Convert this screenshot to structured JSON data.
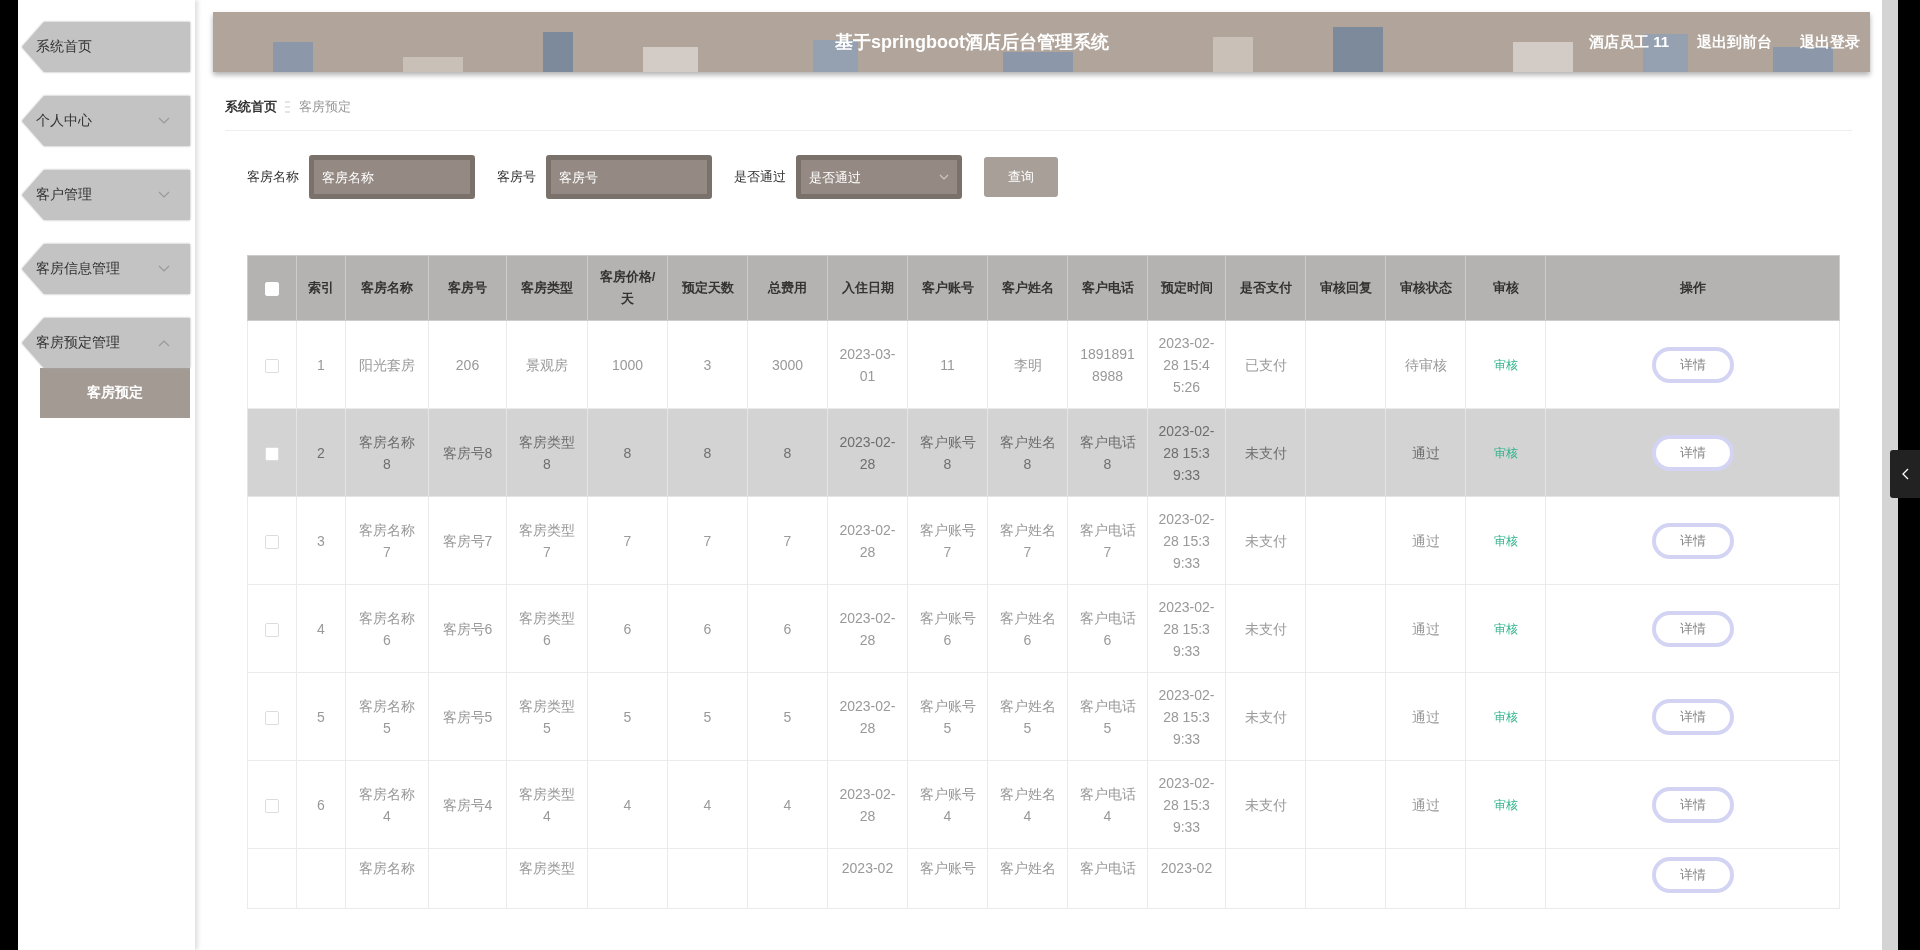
{
  "sidebar": {
    "items": [
      {
        "label": "系统首页",
        "kind": "link"
      },
      {
        "label": "个人中心",
        "kind": "menu",
        "expanded": false
      },
      {
        "label": "客户管理",
        "kind": "menu",
        "expanded": false
      },
      {
        "label": "客房信息管理",
        "kind": "menu",
        "expanded": false
      },
      {
        "label": "客房预定管理",
        "kind": "menu",
        "expanded": true,
        "children": [
          {
            "label": "客房预定",
            "selected": true
          }
        ]
      }
    ]
  },
  "header": {
    "title": "基于springboot酒店后台管理系统",
    "links": [
      "酒店员工 11",
      "退出到前台",
      "退出登录"
    ]
  },
  "breadcrumb": [
    "系统首页",
    "客房预定"
  ],
  "search": {
    "fields": [
      {
        "label": "客房名称",
        "placeholder": "客房名称",
        "kind": "text"
      },
      {
        "label": "客房号",
        "placeholder": "客房号",
        "kind": "text"
      },
      {
        "label": "是否通过",
        "placeholder": "是否通过",
        "kind": "select"
      }
    ],
    "button": "查询"
  },
  "table": {
    "select_all": {
      "checked": false
    },
    "columns": [
      "索引",
      "客房名称",
      "客房号",
      "客房类型",
      "客房价格/天",
      "预定天数",
      "总费用",
      "入住日期",
      "客户账号",
      "客户姓名",
      "客户电话",
      "预定时间",
      "是否支付",
      "审核回复",
      "审核状态",
      "审核",
      "操作"
    ],
    "rows": [
      {
        "kind": "full",
        "selected": false,
        "checked": false,
        "cells": [
          "1",
          "阳光套房",
          "206",
          "景观房",
          "1000",
          "3",
          "3000",
          "2023-03-01",
          "11",
          "李明",
          "18918918988",
          "2023-02-28 15:45:26",
          "已支付",
          null,
          "待审核"
        ],
        "review": "审核",
        "action": "详情"
      },
      {
        "kind": "full",
        "selected": true,
        "checked": false,
        "cells": [
          "2",
          "客房名称8",
          "客房号8",
          "客房类型8",
          "8",
          "8",
          "8",
          "2023-02-28",
          "客户账号8",
          "客户姓名8",
          "客户电话8",
          "2023-02-28 15:39:33",
          "未支付",
          null,
          "通过"
        ],
        "review": "审核",
        "action": "详情"
      },
      {
        "kind": "full",
        "selected": false,
        "checked": false,
        "cells": [
          "3",
          "客房名称7",
          "客房号7",
          "客房类型7",
          "7",
          "7",
          "7",
          "2023-02-28",
          "客户账号7",
          "客户姓名7",
          "客户电话7",
          "2023-02-28 15:39:33",
          "未支付",
          null,
          "通过"
        ],
        "review": "审核",
        "action": "详情"
      },
      {
        "kind": "full",
        "selected": false,
        "checked": false,
        "cells": [
          "4",
          "客房名称6",
          "客房号6",
          "客房类型6",
          "6",
          "6",
          "6",
          "2023-02-28",
          "客户账号6",
          "客户姓名6",
          "客户电话6",
          "2023-02-28 15:39:33",
          "未支付",
          null,
          "通过"
        ],
        "review": "审核",
        "action": "详情"
      },
      {
        "kind": "full",
        "selected": false,
        "checked": false,
        "cells": [
          "5",
          "客房名称5",
          "客房号5",
          "客房类型5",
          "5",
          "5",
          "5",
          "2023-02-28",
          "客户账号5",
          "客户姓名5",
          "客户电话5",
          "2023-02-28 15:39:33",
          "未支付",
          null,
          "通过"
        ],
        "review": "审核",
        "action": "详情"
      },
      {
        "kind": "full",
        "selected": false,
        "checked": false,
        "cells": [
          "6",
          "客房名称4",
          "客房号4",
          "客房类型4",
          "4",
          "4",
          "4",
          "2023-02-28",
          "客户账号4",
          "客户姓名4",
          "客户电话4",
          "2023-02-28 15:39:33",
          "未支付",
          null,
          "通过"
        ],
        "review": "审核",
        "action": "详情"
      },
      {
        "kind": "partial",
        "cells": [
          null,
          "客房名称",
          null,
          "客房类型",
          null,
          null,
          null,
          "2023-02",
          "客户账号",
          "客户姓名",
          "客户电话",
          "2023-02",
          null,
          null,
          null
        ],
        "action": "详情"
      }
    ]
  }
}
